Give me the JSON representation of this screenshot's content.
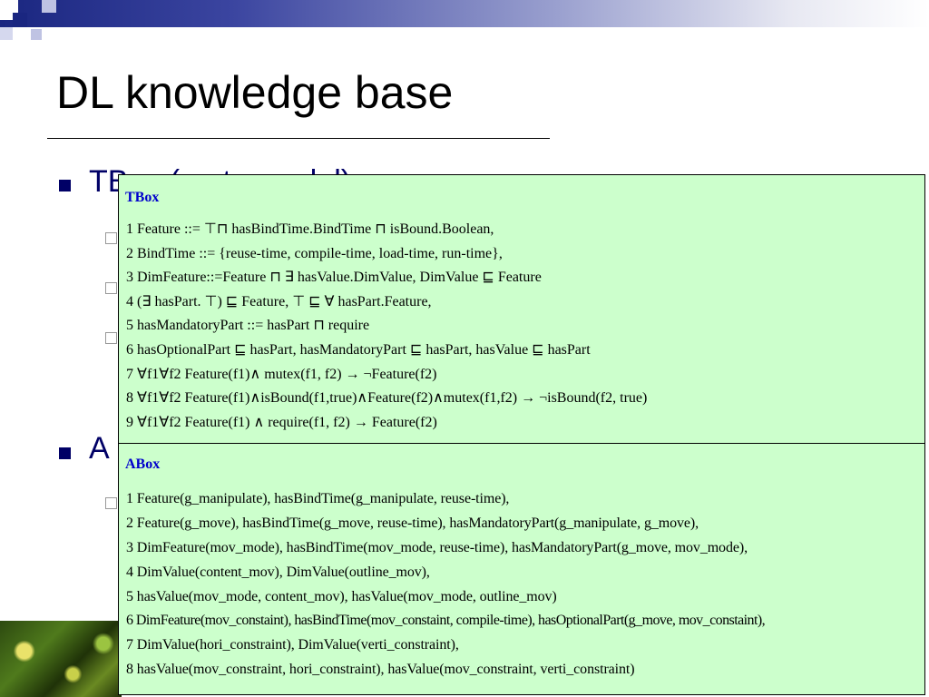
{
  "slide": {
    "title": "DL knowledge base",
    "bullets": [
      {
        "text": "TBox (meta model)"
      },
      {
        "text": "A"
      }
    ]
  },
  "tbox": {
    "heading": "TBox",
    "lines": [
      "1 Feature ::= ⊤⊓ hasBindTime.BindTime ⊓ isBound.Boolean,",
      "2 BindTime ::= {reuse-time, compile-time, load-time, run-time},",
      "3 DimFeature::=Feature ⊓ ∃ hasValue.DimValue, DimValue ⊑ Feature",
      "4 (∃ hasPart. ⊤) ⊑ Feature, ⊤ ⊑ ∀ hasPart.Feature,",
      "5 hasMandatoryPart ::= hasPart ⊓ require",
      "6 hasOptionalPart ⊑ hasPart, hasMandatoryPart ⊑ hasPart, hasValue ⊑ hasPart",
      "7 ∀f1∀f2 Feature(f1)∧ mutex(f1, f2) → ¬Feature(f2)",
      "8 ∀f1∀f2 Feature(f1)∧isBound(f1,true)∧Feature(f2)∧mutex(f1,f2) → ¬isBound(f2, true)",
      "9 ∀f1∀f2 Feature(f1) ∧ require(f1, f2) → Feature(f2)"
    ]
  },
  "abox": {
    "heading": "ABox",
    "lines": [
      "1 Feature(g_manipulate), hasBindTime(g_manipulate, reuse-time),",
      "2 Feature(g_move), hasBindTime(g_move, reuse-time), hasMandatoryPart(g_manipulate, g_move),",
      "3 DimFeature(mov_mode), hasBindTime(mov_mode, reuse-time), hasMandatoryPart(g_move, mov_mode),",
      "4 DimValue(content_mov), DimValue(outline_mov),",
      "5 hasValue(mov_mode, content_mov), hasValue(mov_mode, outline_mov)",
      "6 DimFeature(mov_constaint), hasBindTime(mov_constaint, compile-time), hasOptionalPart(g_move, mov_constaint),",
      "7 DimValue(hori_constraint), DimValue(verti_constraint),",
      "8 hasValue(mov_constraint, hori_constraint), hasValue(mov_constraint, verti_constraint)"
    ]
  }
}
